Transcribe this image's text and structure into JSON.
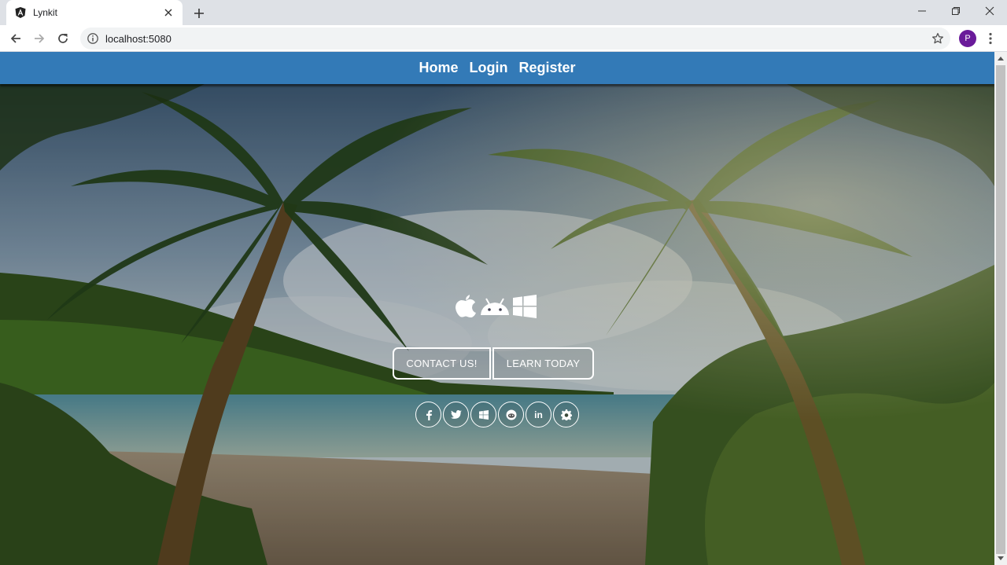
{
  "browser": {
    "tab_title": "Lynkit",
    "url": "localhost:5080",
    "profile_initial": "P"
  },
  "navbar": {
    "links": [
      "Home",
      "Login",
      "Register"
    ]
  },
  "hero": {
    "platform_icons": [
      "apple-icon",
      "android-icon",
      "windows-icon"
    ],
    "buttons": {
      "contact": "CONTACT US!",
      "learn": "LEARN TODAY"
    },
    "social_icons": [
      "facebook-icon",
      "twitter-icon",
      "windows-icon",
      "reddit-icon",
      "linkedin-icon",
      "gear-icon"
    ],
    "linkedin_glyph": "in"
  },
  "colors": {
    "navbar": "#337ab7",
    "tabstrip": "#dee1e6",
    "avatar": "#6a1b9a"
  }
}
